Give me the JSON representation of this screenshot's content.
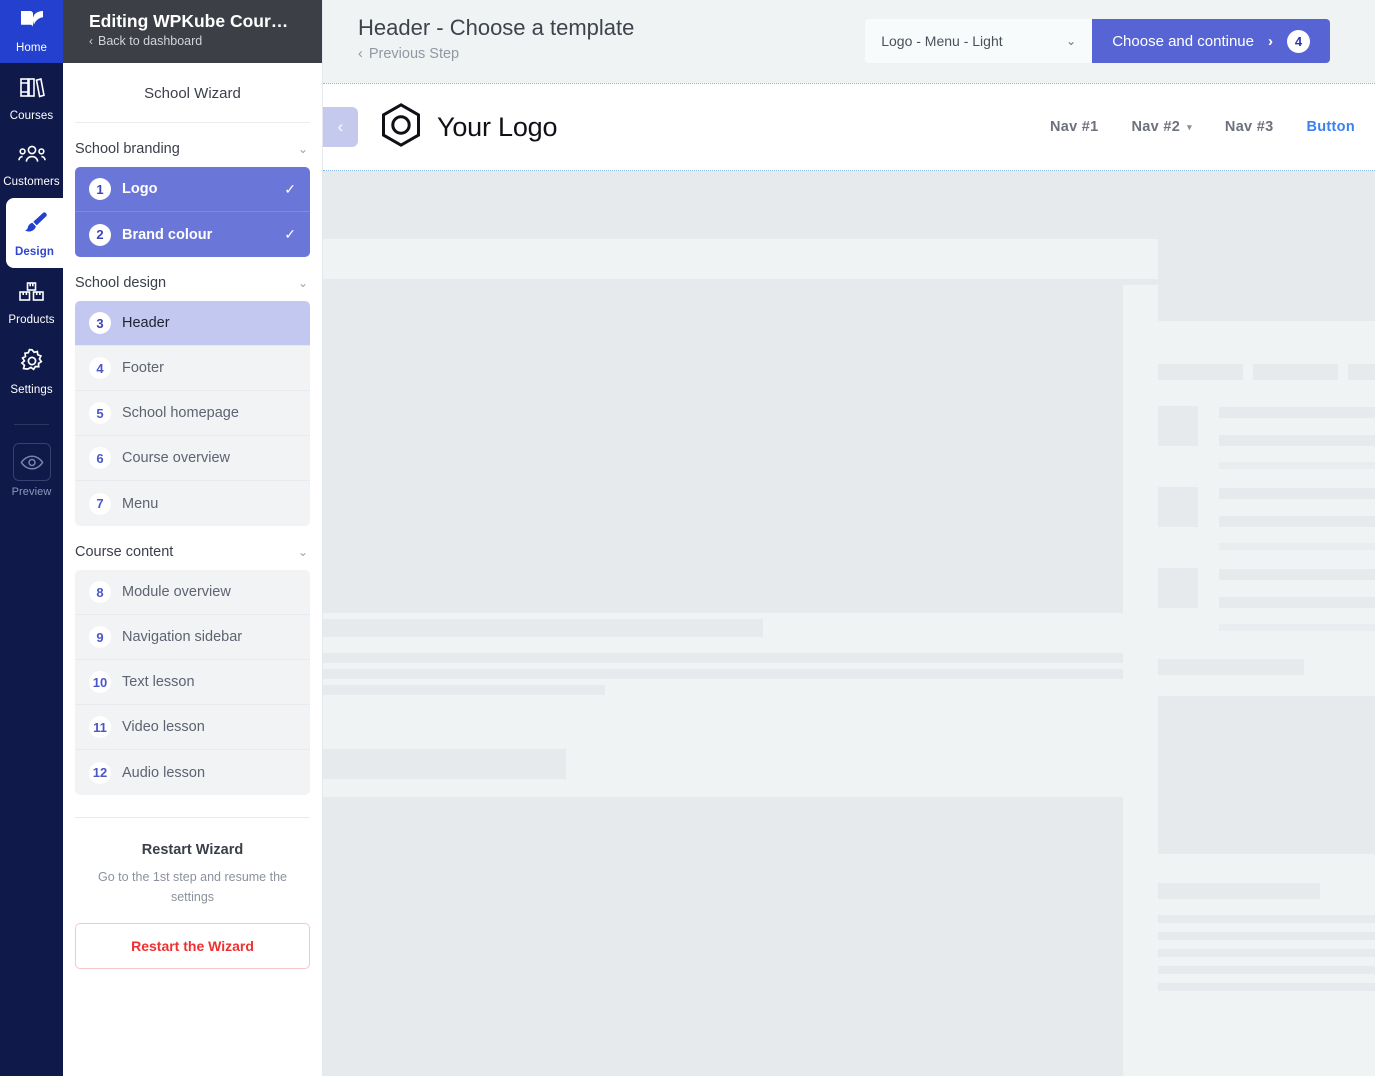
{
  "rail": {
    "items": [
      {
        "label": "Home",
        "icon": "book-leaf-icon",
        "state": "home"
      },
      {
        "label": "Courses",
        "icon": "books-icon",
        "state": "normal"
      },
      {
        "label": "Customers",
        "icon": "people-icon",
        "state": "normal"
      },
      {
        "label": "Design",
        "icon": "paintbrush-icon",
        "state": "active"
      },
      {
        "label": "Products",
        "icon": "boxes-icon",
        "state": "normal"
      },
      {
        "label": "Settings",
        "icon": "gear-icon",
        "state": "normal"
      }
    ],
    "preview": {
      "label": "Preview",
      "icon": "eye-icon"
    }
  },
  "panel": {
    "editing_title": "Editing WPKube Cour…",
    "back_label": "Back to dashboard",
    "back_chevron": "‹",
    "wizard_title": "School Wizard",
    "groups": [
      {
        "title": "School branding",
        "caret": "⌄",
        "steps": [
          {
            "num": "1",
            "label": "Logo",
            "state": "done",
            "tick": "✓"
          },
          {
            "num": "2",
            "label": "Brand colour",
            "state": "done",
            "tick": "✓"
          }
        ]
      },
      {
        "title": "School design",
        "caret": "⌄",
        "steps": [
          {
            "num": "3",
            "label": "Header",
            "state": "current",
            "tick": ""
          },
          {
            "num": "4",
            "label": "Footer",
            "state": "normal",
            "tick": ""
          },
          {
            "num": "5",
            "label": "School homepage",
            "state": "normal",
            "tick": ""
          },
          {
            "num": "6",
            "label": "Course overview",
            "state": "normal",
            "tick": ""
          },
          {
            "num": "7",
            "label": "Menu",
            "state": "normal",
            "tick": ""
          }
        ]
      },
      {
        "title": "Course content",
        "caret": "⌄",
        "steps": [
          {
            "num": "8",
            "label": "Module overview",
            "state": "normal",
            "tick": ""
          },
          {
            "num": "9",
            "label": "Navigation sidebar",
            "state": "normal",
            "tick": ""
          },
          {
            "num": "10",
            "label": "Text lesson",
            "state": "normal",
            "tick": ""
          },
          {
            "num": "11",
            "label": "Video lesson",
            "state": "normal",
            "tick": ""
          },
          {
            "num": "12",
            "label": "Audio lesson",
            "state": "normal",
            "tick": ""
          }
        ]
      }
    ],
    "restart": {
      "heading": "Restart Wizard",
      "description": "Go to the 1st step and resume the settings",
      "button_label": "Restart the Wizard"
    }
  },
  "topbar": {
    "title": "Header - Choose a template",
    "previous_label": "Previous Step",
    "previous_chevron": "‹",
    "template_select_value": "Logo - Menu - Light",
    "template_select_caret": "⌄",
    "choose_label": "Choose and continue",
    "choose_arrow": "›",
    "step_badge": "4"
  },
  "site_preview": {
    "collapse_chevron": "‹",
    "logo_text": "Your Logo",
    "logo_icon": "hexagon-logo-icon",
    "nav": [
      {
        "label": "Nav #1",
        "has_caret": false,
        "caret": ""
      },
      {
        "label": "Nav #2",
        "has_caret": true,
        "caret": "▾"
      },
      {
        "label": "Nav #3",
        "has_caret": false,
        "caret": ""
      }
    ],
    "nav_button_label": "Button"
  },
  "colors": {
    "rail_bg": "#101a4a",
    "rail_home": "#2340cf",
    "accent": "#5764d4",
    "step_done": "#6a77d8",
    "step_current": "#c2c8ef",
    "danger": "#f03030",
    "canvas_bg": "#eff3f4",
    "skeleton": "#e7eaec",
    "nav_link": "#3d80f0"
  }
}
